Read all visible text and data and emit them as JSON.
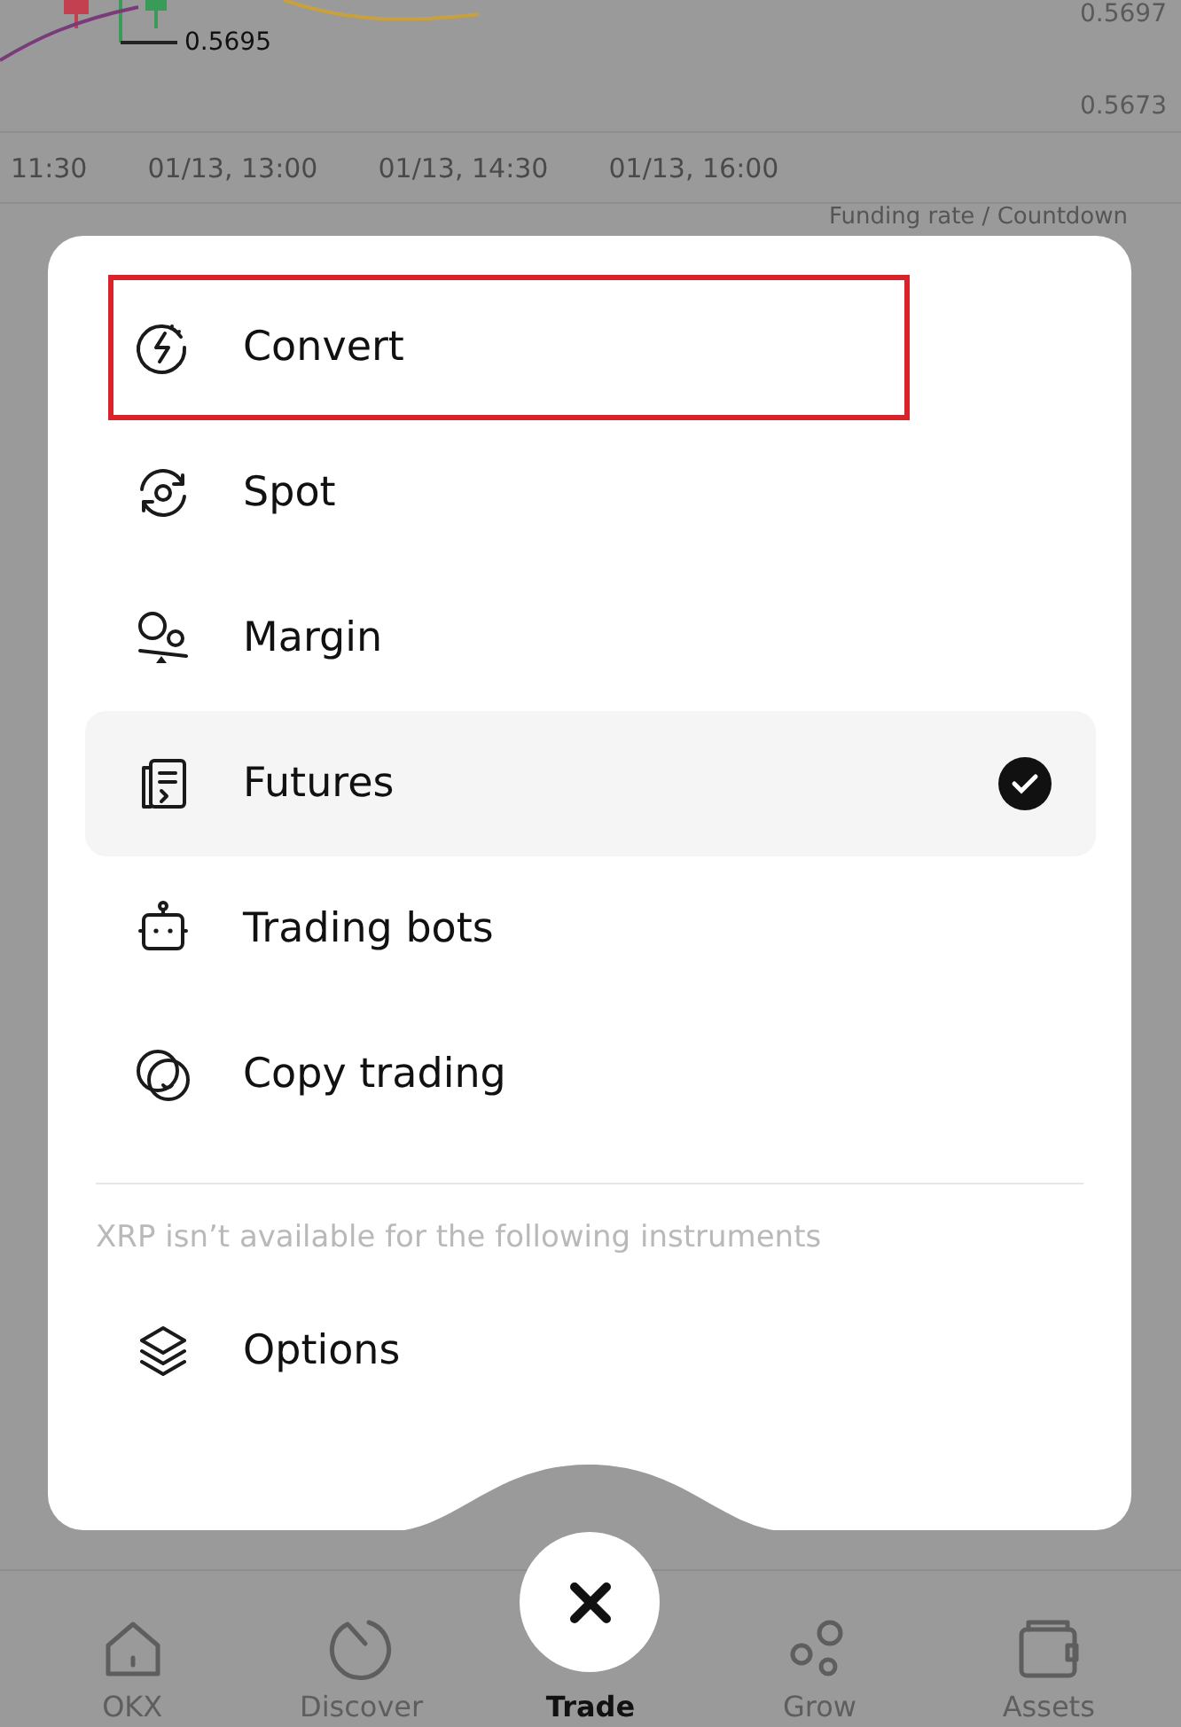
{
  "chart": {
    "price_labels": [
      "0.5697",
      "0.5673"
    ],
    "marker_label": "0.5695",
    "time_labels": [
      "11:30",
      "01/13, 13:00",
      "01/13, 14:30",
      "01/13, 16:00"
    ],
    "funding_label": "Funding rate / Countdown"
  },
  "menu": {
    "items": [
      {
        "kind": "convert",
        "label": "Convert",
        "selected": false,
        "outlined": true
      },
      {
        "kind": "spot",
        "label": "Spot",
        "selected": false,
        "outlined": false
      },
      {
        "kind": "margin",
        "label": "Margin",
        "selected": false,
        "outlined": false
      },
      {
        "kind": "futures",
        "label": "Futures",
        "selected": true,
        "outlined": false
      },
      {
        "kind": "bots",
        "label": "Trading bots",
        "selected": false,
        "outlined": false
      },
      {
        "kind": "copy",
        "label": "Copy trading",
        "selected": false,
        "outlined": false
      }
    ],
    "note": "XRP isn’t available for the following instruments",
    "unavailable": [
      {
        "kind": "options",
        "label": "Options"
      }
    ]
  },
  "nav": [
    {
      "kind": "home",
      "label": "OKX",
      "selected": false
    },
    {
      "kind": "discover",
      "label": "Discover",
      "selected": false
    },
    {
      "kind": "trade",
      "label": "Trade",
      "selected": true
    },
    {
      "kind": "grow",
      "label": "Grow",
      "selected": false
    },
    {
      "kind": "assets",
      "label": "Assets",
      "selected": false
    }
  ]
}
